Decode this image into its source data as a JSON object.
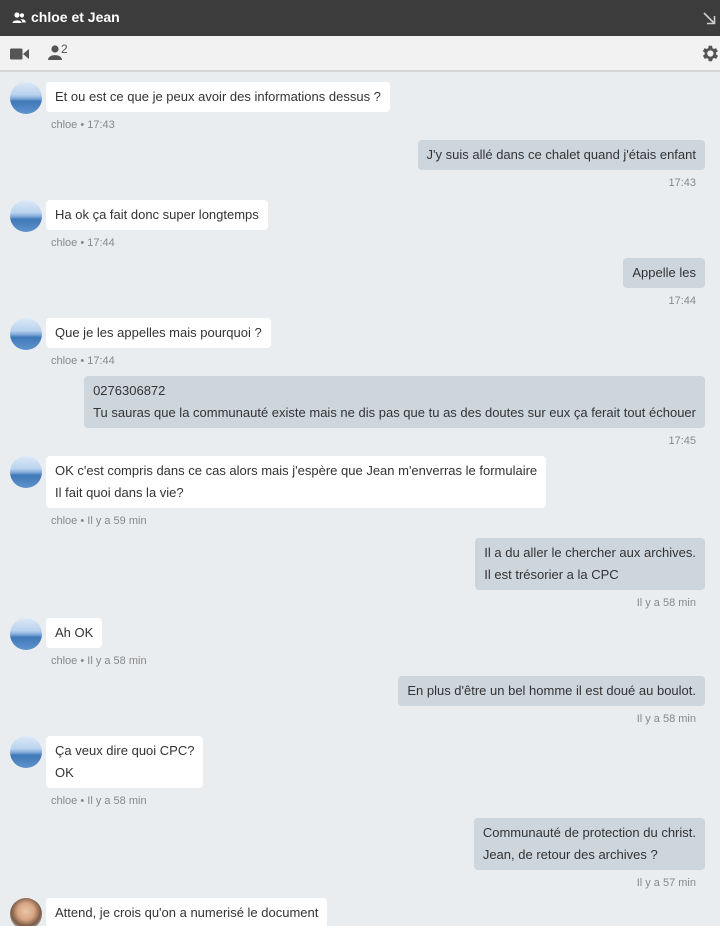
{
  "window": {
    "title": "chloe et Jean"
  },
  "toolbar": {
    "participant_count": "2"
  },
  "messages": [
    {
      "dir": "in",
      "avatar": "lake",
      "lines": [
        "Et ou est ce que je peux avoir des informations dessus ?"
      ],
      "meta": "chloe • 17:43"
    },
    {
      "dir": "out",
      "lines": [
        "J'y suis allé dans ce chalet quand j'étais enfant"
      ],
      "meta": "17:43"
    },
    {
      "dir": "in",
      "avatar": "lake",
      "lines": [
        "Ha ok ça fait donc super longtemps"
      ],
      "meta": "chloe • 17:44"
    },
    {
      "dir": "out",
      "lines": [
        "Appelle les"
      ],
      "meta": "17:44"
    },
    {
      "dir": "in",
      "avatar": "lake",
      "lines": [
        "Que je les appelles mais pourquoi ?"
      ],
      "meta": "chloe • 17:44"
    },
    {
      "dir": "out",
      "lines": [
        "0276306872",
        "Tu sauras que la communauté existe mais ne dis pas que tu as des doutes sur eux ça ferait tout échouer"
      ],
      "meta": "17:45"
    },
    {
      "dir": "in",
      "avatar": "lake",
      "lines": [
        "OK c'est compris dans ce cas alors mais j'espère que Jean m'enverras le formulaire",
        "Il fait quoi dans la vie?"
      ],
      "meta": "chloe • Il y a 59 min"
    },
    {
      "dir": "out",
      "lines": [
        "Il a du aller le chercher aux archives.",
        "Il est trésorier a la CPC"
      ],
      "meta": "Il y a 58 min"
    },
    {
      "dir": "in",
      "avatar": "lake",
      "lines": [
        "Ah OK"
      ],
      "meta": "chloe • Il y a 58 min"
    },
    {
      "dir": "out",
      "lines": [
        "En plus d'être un bel homme il est doué au boulot."
      ],
      "meta": "Il y a 58 min"
    },
    {
      "dir": "in",
      "avatar": "lake",
      "lines": [
        "Ça veux dire quoi CPC?",
        "OK"
      ],
      "meta": "chloe • Il y a 58 min"
    },
    {
      "dir": "out",
      "lines": [
        "Communauté de protection du christ.",
        "Jean, de retour des archives ?"
      ],
      "meta": "Il y a 57 min"
    },
    {
      "dir": "in",
      "avatar": "photo",
      "lines": [
        "Attend, je crois qu'on a numerisé le document"
      ],
      "meta": ""
    }
  ]
}
